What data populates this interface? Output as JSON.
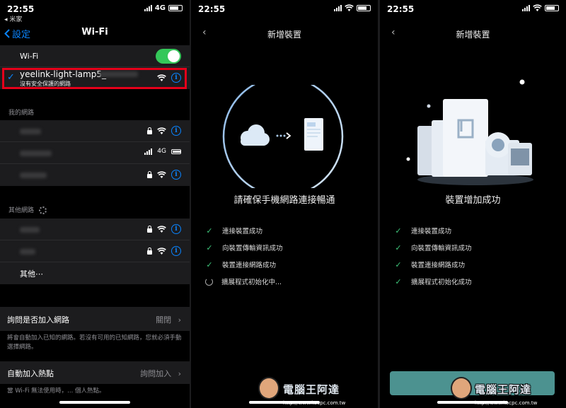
{
  "panel1": {
    "status": {
      "time": "22:55",
      "back_app": "◂ 米家",
      "carrier": "4G"
    },
    "nav": {
      "back_label": "設定",
      "title": "Wi-Fi"
    },
    "wifi_toggle_label": "Wi-Fi",
    "connected": {
      "ssid": "yeelink-light-lamp5_",
      "subtitle": "沒有安全保護的網路"
    },
    "my_networks_header": "我的網路",
    "my_networks_cell_label": "4G",
    "other_networks_header": "其他網路",
    "other_label": "其他⋯",
    "ask_join": {
      "label": "詢問是否加入網路",
      "value": "關閉"
    },
    "ask_join_note": "將會自動加入已知的網路。若沒有可用的已知網路，您就必須手動選擇網路。",
    "auto_hotspot": {
      "label": "自動加入熱點",
      "value": "詢問加入"
    },
    "auto_hotspot_note": "當 Wi-Fi 無法使用時，... 個人熱點。"
  },
  "panel2": {
    "status": {
      "time": "22:55"
    },
    "nav": {
      "title": "新增裝置"
    },
    "heading": "請確保手機網路連接暢通",
    "steps": [
      {
        "label": "連接裝置成功",
        "state": "done"
      },
      {
        "label": "向裝置傳輸資訊成功",
        "state": "done"
      },
      {
        "label": "裝置連接網路成功",
        "state": "done"
      },
      {
        "label": "擴展程式初始化中...",
        "state": "loading"
      }
    ]
  },
  "panel3": {
    "status": {
      "time": "22:55"
    },
    "nav": {
      "title": "新增裝置"
    },
    "heading": "裝置增加成功",
    "steps": [
      {
        "label": "連接裝置成功",
        "state": "done"
      },
      {
        "label": "向裝置傳輸資訊成功",
        "state": "done"
      },
      {
        "label": "裝置連接網路成功",
        "state": "done"
      },
      {
        "label": "擴展程式初始化成功",
        "state": "done"
      }
    ]
  },
  "watermark": {
    "text": "電腦王阿達",
    "url": "http://www.kocpc.com.tw"
  },
  "colors": {
    "ios_blue": "#0a84ff",
    "toggle_green": "#34c759",
    "highlight_red": "#e5001a",
    "success_green": "#3ec47a",
    "button_teal": "#5fb6b4"
  }
}
